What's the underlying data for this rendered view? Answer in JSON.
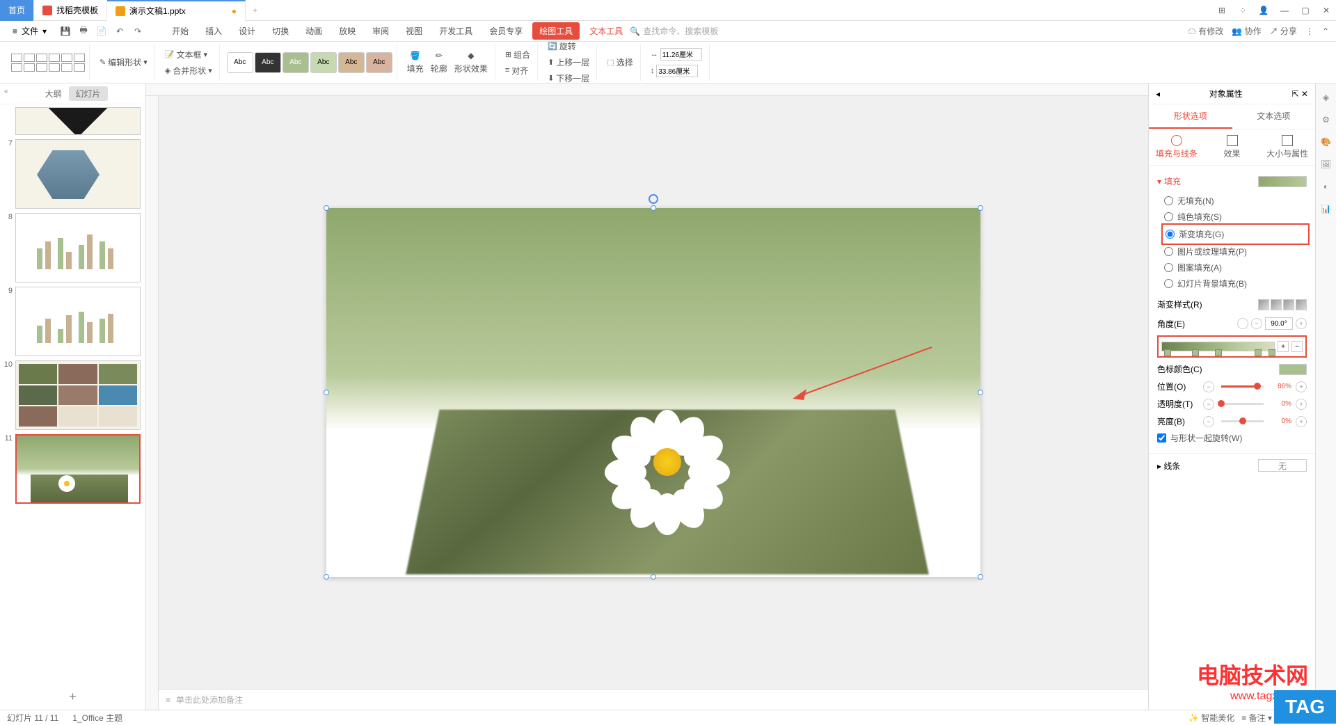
{
  "tabs": {
    "home": "首页",
    "templates": "找稻壳模板",
    "file": "演示文稿1.pptx"
  },
  "menu": {
    "file": "文件",
    "items": [
      "开始",
      "插入",
      "设计",
      "切换",
      "动画",
      "放映",
      "审阅",
      "视图",
      "开发工具",
      "会员专享"
    ],
    "drawTools": "绘图工具",
    "textTools": "文本工具",
    "searchPlaceholder": "查找命令、搜索模板"
  },
  "topRight": {
    "pending": "有修改",
    "collab": "协作",
    "share": "分享"
  },
  "ribbon": {
    "editShape": "编辑形状",
    "textBox": "文本框",
    "mergeShape": "合并形状",
    "styleLabel": "Abc",
    "fill": "填充",
    "outline": "轮廓",
    "shapeEffect": "形状效果",
    "group": "组合",
    "align": "对齐",
    "rotate": "旋转",
    "bringForward": "上移一层",
    "sendBackward": "下移一层",
    "select": "选择",
    "width": "11.26厘米",
    "height": "33.86厘米"
  },
  "sideTabs": {
    "outline": "大纲",
    "slides": "幻灯片"
  },
  "thumbs": [
    "7",
    "8",
    "9",
    "10",
    "11"
  ],
  "notes": "单击此处添加备注",
  "propPanel": {
    "title": "对象属性",
    "tabs": {
      "shape": "形状选项",
      "text": "文本选项"
    },
    "subtabs": {
      "fill": "填充与线条",
      "effect": "效果",
      "size": "大小与属性"
    },
    "fillSection": "填充",
    "fillOptions": {
      "none": "无填充(N)",
      "solid": "纯色填充(S)",
      "gradient": "渐变填充(G)",
      "picture": "图片或纹理填充(P)",
      "pattern": "图案填充(A)",
      "slideBg": "幻灯片背景填充(B)"
    },
    "gradStyle": "渐变样式(R)",
    "angle": "角度(E)",
    "angleVal": "90.0°",
    "stopColor": "色标颜色(C)",
    "position": "位置(O)",
    "positionVal": "86%",
    "transparency": "透明度(T)",
    "transparencyVal": "0%",
    "brightness": "亮度(B)",
    "brightnessVal": "0%",
    "rotateWithShape": "与形状一起旋转(W)",
    "lineSection": "线条",
    "lineNone": "无"
  },
  "status": {
    "slideNum": "幻灯片 11 / 11",
    "theme": "1_Office 主题",
    "aiBeautify": "智能美化",
    "notes": "备注"
  },
  "watermark": {
    "text": "电脑技术网",
    "url": "www.tagxp.com",
    "tag": "TAG"
  }
}
